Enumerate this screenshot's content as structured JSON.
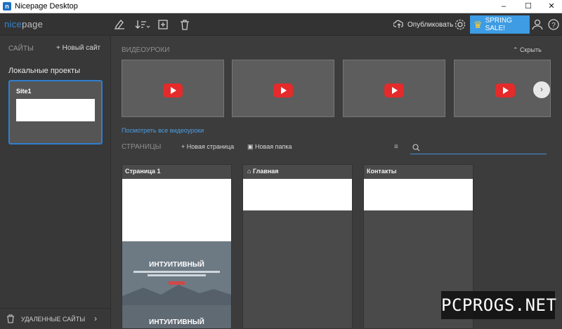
{
  "window": {
    "title": "Nicepage Desktop",
    "app_icon_letter": "n",
    "minimize": "–",
    "maximize": "☐",
    "close": "✕"
  },
  "toolbar": {
    "logo_main": "nice",
    "logo_suffix": "page",
    "publish_label": "Опубликовать",
    "sale_label": "SPRING SALE!",
    "icons": [
      "paint-brush-icon",
      "sort-icon",
      "add-page-icon",
      "trash-icon",
      "cloud-upload-icon",
      "gear-icon",
      "crown-icon",
      "user-icon",
      "help-icon"
    ],
    "accent_color": "#3d9ce4"
  },
  "sidebar": {
    "sites_header": "САЙТЫ",
    "new_site_label": "+ Новый сайт",
    "local_projects_header": "Локальные проекты",
    "sites": [
      {
        "name": "Site1"
      }
    ],
    "deleted_sites_label": "УДАЛЕННЫЕ САЙТЫ",
    "deleted_chevron": "›"
  },
  "videos": {
    "header": "ВИДЕОУРОКИ",
    "hide_label": "⌃ Скрыть",
    "count": 4,
    "next_label": "›",
    "all_videos_link": "Посмотреть все видеоуроки"
  },
  "pages": {
    "header": "СТРАНИЦЫ",
    "new_page_label": "+ Новая страница",
    "new_folder_label": "Новая папка",
    "search_placeholder": "",
    "items": [
      {
        "title": "Страница 1",
        "hero_text": "ИНТУИТИВНЫЙ",
        "hero_text_2": "ИНТУИТИВНЫЙ"
      },
      {
        "title": "Главная",
        "home": true
      },
      {
        "title": "Контакты"
      }
    ]
  },
  "watermark": "PCPROGS.NET"
}
